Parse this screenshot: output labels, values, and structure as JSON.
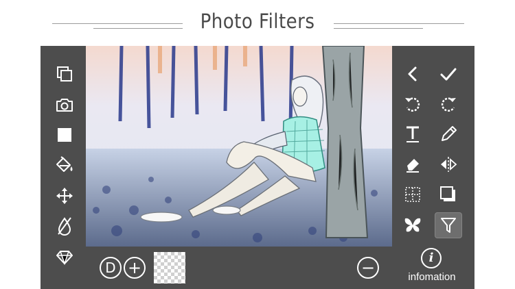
{
  "header": {
    "title": "Photo Filters"
  },
  "left_toolbar": {
    "items": [
      "layers-icon",
      "camera-icon",
      "color-square-icon",
      "fill-bucket-icon",
      "move-icon",
      "opacity-icon",
      "diamond-icon"
    ]
  },
  "right_toolbar": {
    "items": [
      "back-icon",
      "confirm-check-icon",
      "undo-icon",
      "redo-icon",
      "text-icon",
      "pencil-icon",
      "eraser-icon",
      "flip-icon",
      "grid-icon",
      "shadow-icon",
      "butterfly-icon",
      "filter-icon"
    ],
    "active": "filter-icon"
  },
  "bottom_bar": {
    "d_label": "D",
    "plus_label": "+",
    "minus_label": "−",
    "info_symbol": "i",
    "info_label": "infomation"
  },
  "colors": {
    "panel": "#4d4d4d",
    "icon": "#ffffff",
    "title": "#4a4a4a"
  }
}
